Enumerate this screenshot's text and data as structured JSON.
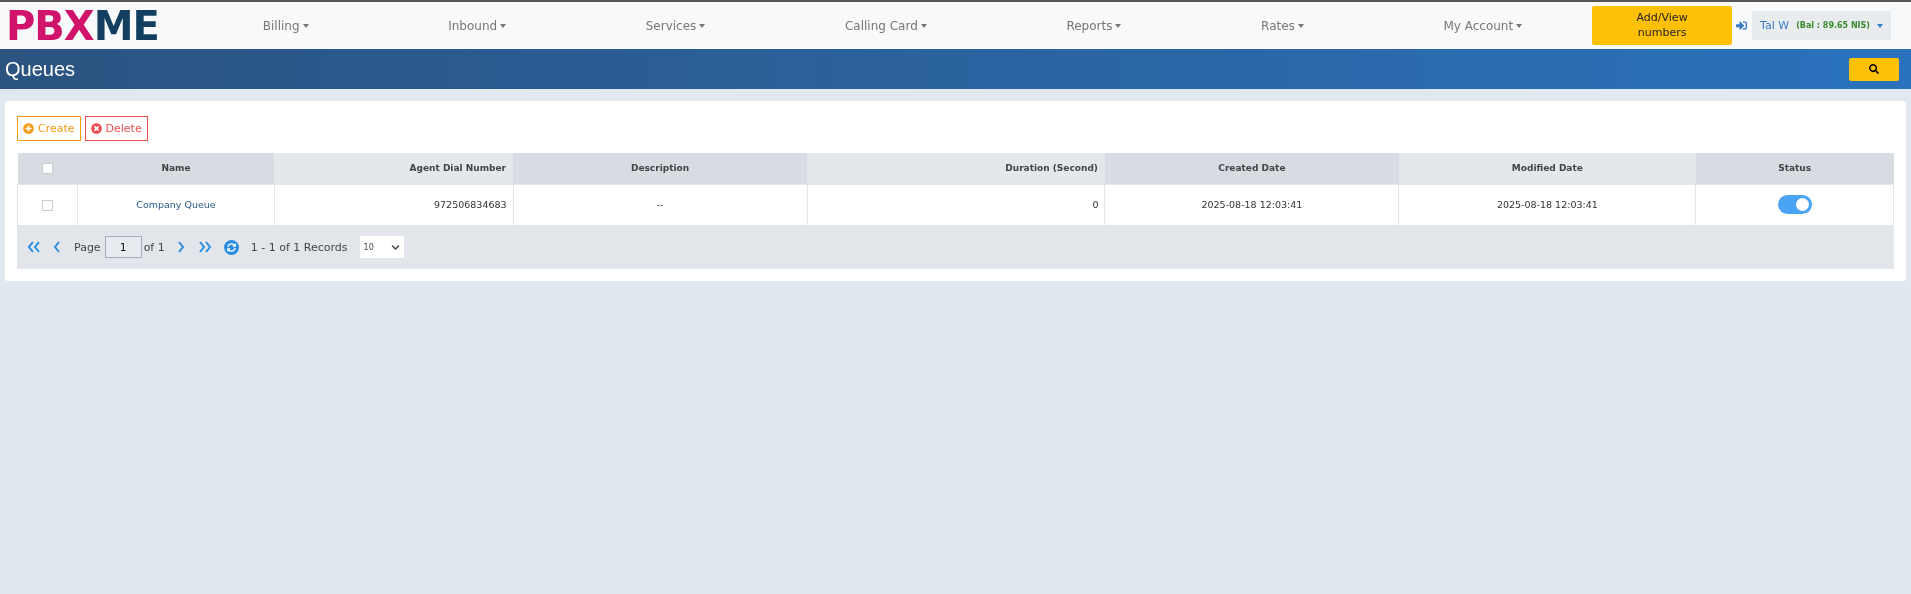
{
  "logo": {
    "first": "PBX",
    "second": "ME"
  },
  "nav": [
    {
      "label": "Billing"
    },
    {
      "label": "Inbound"
    },
    {
      "label": "Services"
    },
    {
      "label": "Calling Card"
    },
    {
      "label": "Reports"
    },
    {
      "label": "Rates"
    },
    {
      "label": "My Account"
    }
  ],
  "add_numbers_button": "Add/View numbers",
  "user": {
    "name": "Tal W",
    "balance": "(Bal : 89.65 NIS)"
  },
  "page_title": "Queues",
  "actions": [
    {
      "kind": "create",
      "label": "Create"
    },
    {
      "kind": "delete",
      "label": "Delete"
    }
  ],
  "table": {
    "select_all": {
      "checked": false
    },
    "columns": [
      {
        "label": "Name"
      },
      {
        "label": "Agent Dial Number"
      },
      {
        "label": "Description"
      },
      {
        "label": "Duration (Second)"
      },
      {
        "label": "Created Date"
      },
      {
        "label": "Modified Date"
      },
      {
        "label": "Status"
      }
    ],
    "rows": [
      {
        "checked": false,
        "name": "Company Queue",
        "agent_dial_number": "972506834683",
        "description": "--",
        "duration": "0",
        "created": "2025-08-18 12:03:41",
        "modified": "2025-08-18 12:03:41",
        "status_on": true
      }
    ]
  },
  "pager": {
    "page_label": "Page",
    "page": "1",
    "of": "of 1",
    "records": "1 - 1 of 1 Records",
    "page_size": "10"
  }
}
